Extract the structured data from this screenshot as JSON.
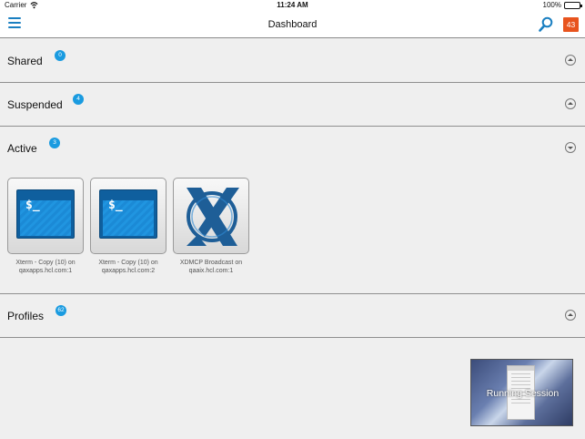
{
  "statusbar": {
    "carrier": "Carrier",
    "time": "11:24 AM",
    "battery": "100%"
  },
  "navbar": {
    "title": "Dashboard",
    "notification_count": "43"
  },
  "sections": [
    {
      "label": "Shared",
      "count": "0",
      "expanded": false
    },
    {
      "label": "Suspended",
      "count": "4",
      "expanded": false
    },
    {
      "label": "Active",
      "count": "3",
      "expanded": true
    },
    {
      "label": "Profiles",
      "count": "62",
      "expanded": false
    }
  ],
  "active_sessions": [
    {
      "line1": "Xterm - Copy (10) on",
      "line2": "qaxapps.hcl.com:1",
      "icon": "terminal-icon"
    },
    {
      "line1": "Xterm - Copy (10) on",
      "line2": "qaxapps.hcl.com:2",
      "icon": "terminal-icon"
    },
    {
      "line1": "XDMCP Broadcast on",
      "line2": "qaaix.hcl.com:1",
      "icon": "x-logo-icon"
    }
  ],
  "terminal_prompt": "$_",
  "running_session": {
    "label": "Running Session"
  },
  "colors": {
    "accent": "#1a7fc1",
    "badge": "#1a9be0",
    "notification": "#e8541e"
  }
}
